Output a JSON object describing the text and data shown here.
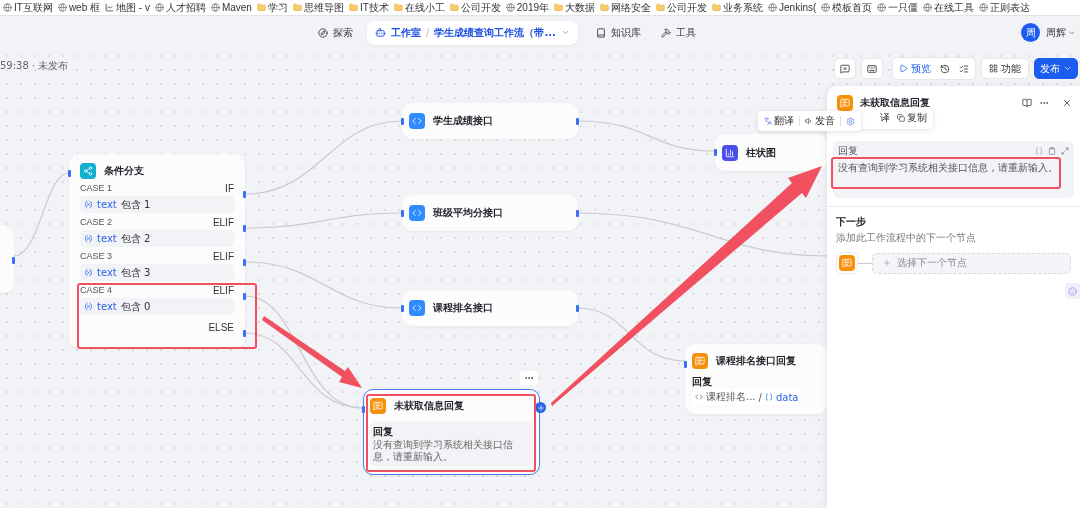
{
  "bookmarks": [
    {
      "label": "IT互联网",
      "kind": "site"
    },
    {
      "label": "web 框",
      "kind": "site"
    },
    {
      "label": "地图 - v",
      "kind": "chart"
    },
    {
      "label": "人才招聘",
      "kind": "site"
    },
    {
      "label": "Maven",
      "kind": "site"
    },
    {
      "label": "学习",
      "kind": "folder"
    },
    {
      "label": "思维导图",
      "kind": "folder"
    },
    {
      "label": "IT技术",
      "kind": "folder"
    },
    {
      "label": "在线小工",
      "kind": "folder"
    },
    {
      "label": "公司开发",
      "kind": "folder"
    },
    {
      "label": "2019年",
      "kind": "site"
    },
    {
      "label": "大数据",
      "kind": "folder"
    },
    {
      "label": "网络安全",
      "kind": "folder"
    },
    {
      "label": "公司开发",
      "kind": "folder"
    },
    {
      "label": "业务系统",
      "kind": "folder"
    },
    {
      "label": "Jenkins(",
      "kind": "site"
    },
    {
      "label": "模板首页",
      "kind": "site"
    },
    {
      "label": "一只僵",
      "kind": "site"
    },
    {
      "label": "在线工具",
      "kind": "site"
    },
    {
      "label": "正则表达",
      "kind": "site"
    }
  ],
  "nav": {
    "explore": "探索",
    "breadcrumb": {
      "root": "工作室",
      "separator": "/",
      "current": "学生成绩查询工作流（带..."
    },
    "links": [
      {
        "label": "知识库",
        "kind": "knowledge"
      },
      {
        "label": "工具",
        "kind": "tools"
      }
    ],
    "user": {
      "avatar": "周",
      "name": "周辉"
    }
  },
  "status": "59:38 · 未发布",
  "toolbar": {
    "preview": "预览",
    "features": "功能",
    "publish": "发布"
  },
  "nodes": [
    {
      "kind": "partial",
      "selected": false
    },
    {
      "kind": "branch",
      "title": "条件分支",
      "selected": false,
      "cases": [
        {
          "label": "CASE 1",
          "branch": "IF",
          "variable": "text",
          "operator": "包含",
          "value": "1"
        },
        {
          "label": "CASE 2",
          "branch": "ELIF",
          "variable": "text",
          "operator": "包含",
          "value": "2"
        },
        {
          "label": "CASE 3",
          "branch": "ELIF",
          "variable": "text",
          "operator": "包含",
          "value": "3"
        },
        {
          "label": "CASE 4",
          "branch": "ELIF",
          "variable": "text",
          "operator": "包含",
          "value": "0"
        }
      ],
      "else": "ELSE"
    },
    {
      "kind": "api",
      "title": "学生成绩接口",
      "selected": false
    },
    {
      "kind": "api",
      "title": "班级平均分接口",
      "selected": false
    },
    {
      "kind": "api",
      "title": "课程排名接口",
      "selected": false
    },
    {
      "kind": "chart",
      "title": "柱状图",
      "selected": false
    },
    {
      "kind": "reply",
      "title": "课程排名接口回复",
      "selected": false,
      "label": "回复",
      "source": "课程排名...",
      "separator": "/",
      "variable": "data"
    },
    {
      "kind": "reply",
      "title": "未获取信息回复",
      "selected": true,
      "label": "回复",
      "text": "没有查询到学习系统相关接口信息，请重新输入。"
    }
  ],
  "panel": {
    "title": "未获取信息回复",
    "reply_label": "回复",
    "reply_text": "没有查询到学习系统相关接口信息，请重新输入。",
    "next_title": "下一步",
    "next_hint": "添加此工作流程中的下一个节点",
    "next_select": "选择下一个节点"
  },
  "popup_back": {
    "items": [
      "译",
      "复制"
    ]
  },
  "popup_front": {
    "items": [
      "翻译",
      "发音"
    ]
  }
}
